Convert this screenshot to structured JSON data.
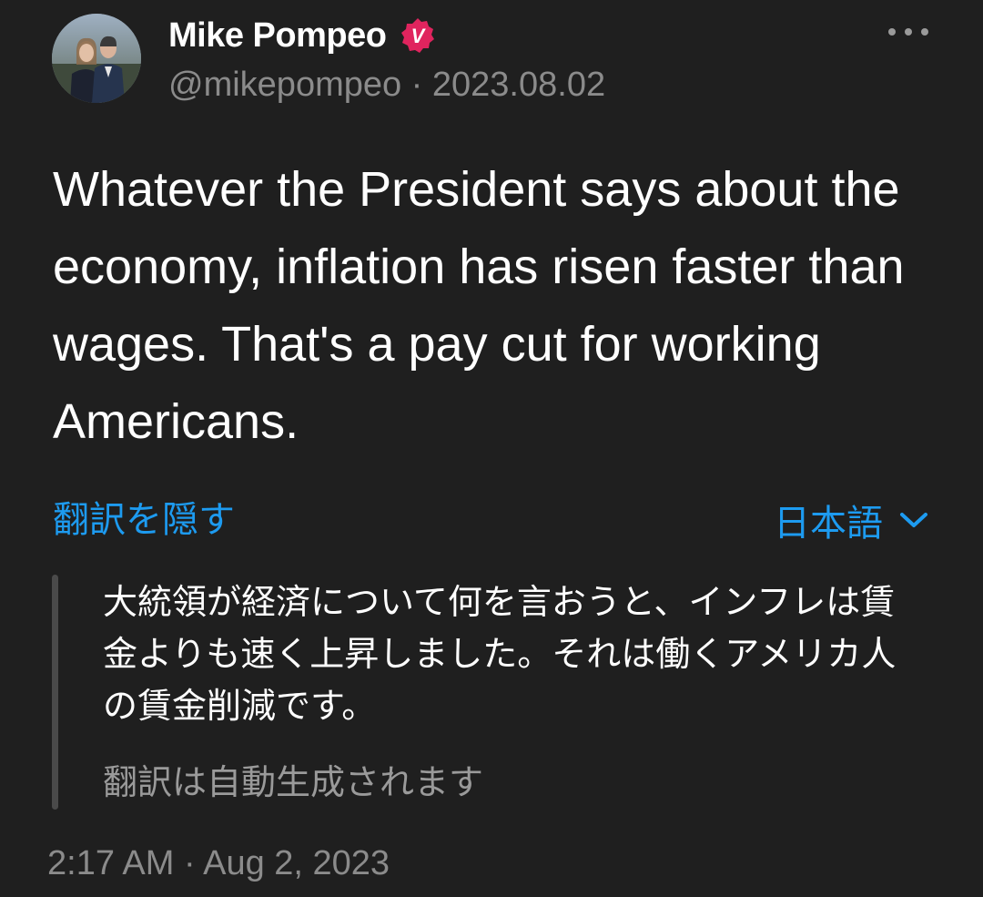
{
  "author": {
    "display_name": "Mike Pompeo",
    "handle": "@mikepompeo",
    "date": "2023.08.02",
    "handle_line": "@mikepompeo · 2023.08.02",
    "verified_badge": "V",
    "verified_color": "#e0245e"
  },
  "tweet": {
    "text": "Whatever the President says about the economy, inflation has risen faster than wages. That's a pay cut for working Americans."
  },
  "translation": {
    "hide_label": "翻訳を隠す",
    "language_label": "日本語",
    "text": "大統領が経済について何を言おうと、インフレは賃金よりも速く上昇しました。それは働くアメリカ人の賃金削減です。",
    "auto_note": "翻訳は自動生成されます"
  },
  "footer": {
    "timestamp": "2:17 AM · Aug 2, 2023"
  },
  "icons": {
    "more": "more-options-icon",
    "dropdown": "chevron-down-icon",
    "verified": "verified-badge-icon"
  },
  "colors": {
    "background": "#1f1f1f",
    "accent": "#1d9bf0",
    "secondary_text": "#8b8b8b"
  }
}
